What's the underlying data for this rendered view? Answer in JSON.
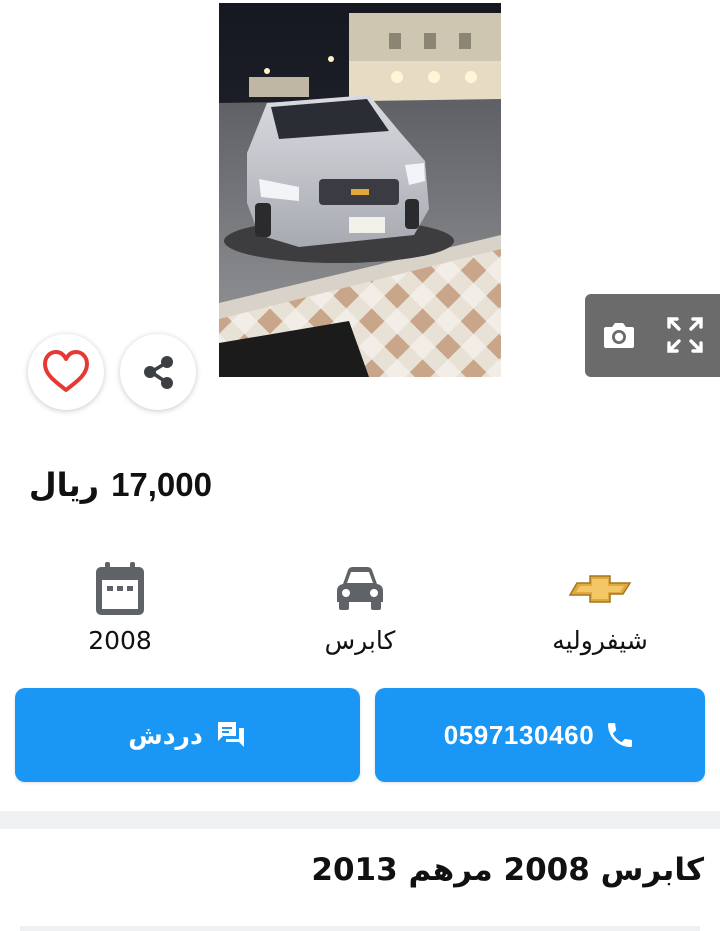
{
  "listing": {
    "price_amount": "17,000",
    "currency": "ريال",
    "title": "كابرس 2008 مرهم 2013"
  },
  "specs": [
    {
      "label": "2008",
      "icon": "calendar-icon"
    },
    {
      "label": "كابرس",
      "icon": "car-icon"
    },
    {
      "label": "شيفروليه",
      "icon": "chevrolet-logo"
    }
  ],
  "actions": {
    "chat_label": "دردش",
    "phone_number": "0597130460"
  },
  "gallery": {
    "controls": [
      "camera-icon",
      "fullscreen-icon",
      "share-icon",
      "heart-icon"
    ]
  },
  "colors": {
    "primary_button": "#1a97f5",
    "heart": "#e53935",
    "overlay": "#6b6b6b",
    "chevrolet_gold": "#e0a93a"
  }
}
